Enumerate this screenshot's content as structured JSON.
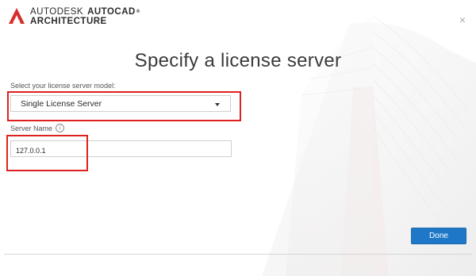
{
  "header": {
    "brand": "AUTODESK",
    "product": "AUTOCAD",
    "trademark": "®",
    "edition": "ARCHITECTURE",
    "logo_icon": "autocad-a-logo",
    "close_label": "×"
  },
  "page": {
    "title": "Specify a license server"
  },
  "license_model": {
    "label": "Select your license server model:",
    "selected": "Single License Server"
  },
  "server_name": {
    "label": "Server Name",
    "info_icon": "info-icon",
    "info_glyph": "i",
    "value": "127.0.0.1"
  },
  "footer": {
    "done_label": "Done"
  },
  "colors": {
    "accent": "#1f78c7",
    "highlight": "#e02020",
    "logo": "#d62d2d"
  }
}
